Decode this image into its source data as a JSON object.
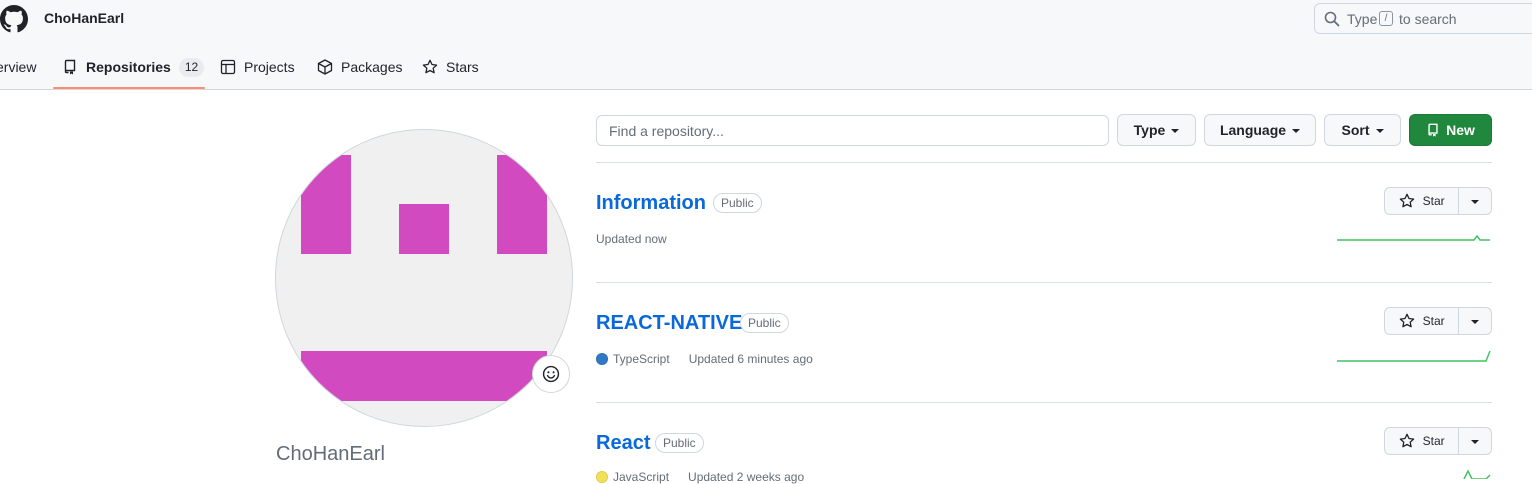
{
  "header": {
    "username": "ChoHanEarl",
    "search": {
      "pre": "Type",
      "key": "/",
      "post": "to search"
    }
  },
  "tabs": [
    {
      "label": "Overview",
      "visible_text": "erview"
    },
    {
      "label": "Repositories",
      "count": "12",
      "selected": true
    },
    {
      "label": "Projects"
    },
    {
      "label": "Packages"
    },
    {
      "label": "Stars"
    }
  ],
  "profile": {
    "name": "ChoHanEarl"
  },
  "toolbar": {
    "find_placeholder": "Find a repository...",
    "type_label": "Type",
    "language_label": "Language",
    "sort_label": "Sort",
    "new_label": "New"
  },
  "repos": [
    {
      "name": "Information",
      "visibility": "Public",
      "language": "",
      "updated": "Updated now",
      "star_label": "Star"
    },
    {
      "name": "REACT-NATIVE",
      "visibility": "Public",
      "language": "TypeScript",
      "language_color": "#3178c6",
      "updated": "Updated 6 minutes ago",
      "star_label": "Star"
    },
    {
      "name": "React",
      "visibility": "Public",
      "language": "JavaScript",
      "language_color": "#f1e05a",
      "updated": "Updated 2 weeks ago",
      "star_label": "Star"
    }
  ],
  "colors": {
    "accent_green": "#1f883d",
    "link_blue": "#0969da",
    "tab_underline": "#fd8c73",
    "avatar_pink": "#d14abf",
    "sparkline": "#40c463"
  },
  "icons": [
    "github-logo-icon",
    "search-icon",
    "book-icon",
    "table-icon",
    "package-icon",
    "star-icon",
    "repo-icon",
    "smiley-icon",
    "triangle-down-icon"
  ]
}
